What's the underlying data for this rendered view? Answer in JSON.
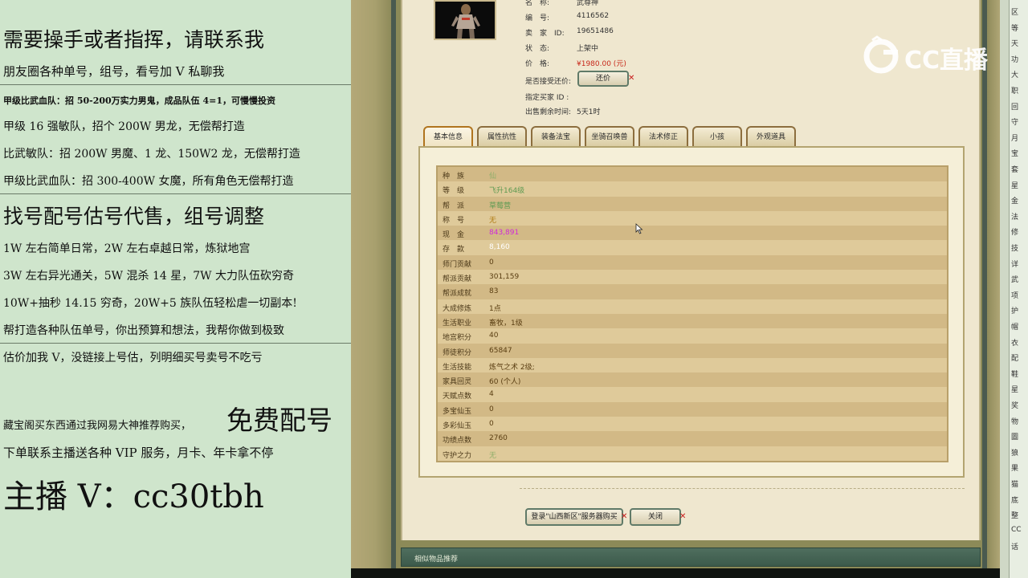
{
  "promo": {
    "lines": [
      "需要操手或者指挥，请联系我",
      "朋友圈各种单号，组号，看号加 V 私聊我",
      "甲级比武血队：招 50-200万实力男鬼，成品队伍 4=1，可慢慢投资",
      "甲级 16 强敏队，招个 200W 男龙，无偿帮打造",
      "比武敏队：招 200W 男魔、1 龙、150W2 龙，无偿帮打造",
      "甲级比武血队：招 300-400W 女魔，所有角色无偿帮打造",
      "找号配号估号代售，组号调整",
      "1W 左右简单日常，2W 左右卓越日常，炼狱地宫",
      "3W 左右异光通关，5W 混杀 14 星，7W 大力队伍砍穷奇",
      "10W+抽秒 14.15 穷奇，20W+5 族队伍轻松虐一切副本!",
      "帮打造各种队伍单号，你出预算和想法，我帮你做到极致",
      "估价加我 V，没链接上号估，列明细买号卖号不吃亏",
      "藏宝阁买东西通过我网易大神推荐购买，",
      "免费配号",
      "下单联系主播送各种 VIP 服务，月卡、年卡拿不停",
      "主播 V：cc30tbh"
    ]
  },
  "listing": {
    "name_label": "名　称:",
    "name_value": "武尊神",
    "id_label": "编　号:",
    "id_value": "4116562",
    "seller_label": "卖　家　ID:",
    "seller_value": "19651486",
    "status_label": "状　态:",
    "status_value": "上架中",
    "price_label": "价　格:",
    "price_value": "¥1980.00 (元)",
    "counter_label": "是否接受还价:",
    "counter_button": "还价",
    "buyer_label": "指定买家 ID :",
    "buyer_value": "",
    "time_label": "出售剩余时间:",
    "time_value": "5天1时"
  },
  "tabs": [
    "基本信息",
    "属性抗性",
    "装备法宝",
    "坐骑召唤兽",
    "法术修正",
    "小孩",
    "外观道具"
  ],
  "attributes": [
    {
      "k": "种　族",
      "v": "仙",
      "color": "#8fae6a"
    },
    {
      "k": "等　级",
      "v": "飞升164级",
      "color": "#5e9a52"
    },
    {
      "k": "帮　派",
      "v": "草莓营",
      "color": "#5e9a52"
    },
    {
      "k": "称　号",
      "v": "无",
      "color": "#b07a10"
    },
    {
      "k": "现　金",
      "v": "843,891",
      "color": "#d02ad8"
    },
    {
      "k": "存　款",
      "v": "8,160",
      "color": "#ffffff"
    },
    {
      "k": "师门贡献",
      "v": "0",
      "color": "#5a3e12"
    },
    {
      "k": "帮派贡献",
      "v": "301,159",
      "color": "#5a3e12"
    },
    {
      "k": "帮派成就",
      "v": "83",
      "color": "#5a3e12"
    },
    {
      "k": "大成修炼",
      "v": "1点",
      "color": "#5a3e12"
    },
    {
      "k": "生活职业",
      "v": "畜牧，1级",
      "color": "#5a3e12"
    },
    {
      "k": "地宫积分",
      "v": "40",
      "color": "#5a3e12"
    },
    {
      "k": "师徒积分",
      "v": "65847",
      "color": "#5a3e12"
    },
    {
      "k": "生活技能",
      "v": "炼气之术 2级;",
      "color": "#5a3e12"
    },
    {
      "k": "家具回灵",
      "v": "60 (个人)",
      "color": "#5a3e12"
    },
    {
      "k": "天赋点数",
      "v": "4",
      "color": "#5a3e12"
    },
    {
      "k": "多宝仙玉",
      "v": "0",
      "color": "#5a3e12"
    },
    {
      "k": "多彩仙玉",
      "v": "0",
      "color": "#5a3e12"
    },
    {
      "k": "功绩点数",
      "v": "2760",
      "color": "#5a3e12"
    },
    {
      "k": "守护之力",
      "v": "无",
      "color": "#8fae6a"
    }
  ],
  "actions": {
    "login_buy": "登录\"山西新区\"服务器购买",
    "close": "关闭"
  },
  "recommend_title": "相似物品推荐",
  "watermark": "CC直播",
  "sliver_text": [
    "区",
    "等",
    "天",
    "功",
    "大",
    "职",
    "回",
    "守",
    "月",
    "宝",
    "套",
    "星",
    "金",
    "法",
    "修",
    "技",
    "详",
    "武",
    "项",
    "护",
    "帽",
    "衣",
    "配",
    "鞋",
    "星",
    "奖",
    "物",
    "圖",
    "狼",
    "果",
    "猫",
    "底",
    "整",
    "CC",
    "话"
  ]
}
